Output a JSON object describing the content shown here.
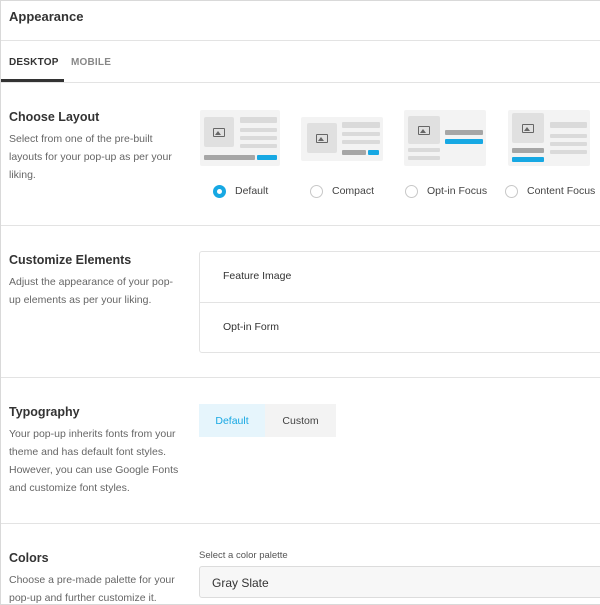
{
  "header": {
    "title": "Appearance"
  },
  "tabs": [
    {
      "label": "DESKTOP",
      "active": true
    },
    {
      "label": "MOBILE",
      "active": false
    }
  ],
  "layout_section": {
    "title": "Choose Layout",
    "description": "Select from one of the pre-built layouts for your pop-up as per your liking.",
    "options": [
      {
        "label": "Default",
        "selected": true
      },
      {
        "label": "Compact",
        "selected": false
      },
      {
        "label": "Opt-in Focus",
        "selected": false
      },
      {
        "label": "Content Focus",
        "selected": false
      }
    ]
  },
  "elements_section": {
    "title": "Customize Elements",
    "description": "Adjust the appearance of your pop-up elements as per your liking.",
    "items": [
      "Feature Image",
      "Opt-in Form"
    ]
  },
  "typography_section": {
    "title": "Typography",
    "description": "Your pop-up inherits fonts from your theme and has default font styles. However, you can use Google Fonts and customize font styles.",
    "options": [
      {
        "label": "Default",
        "active": true
      },
      {
        "label": "Custom",
        "active": false
      }
    ]
  },
  "colors_section": {
    "title": "Colors",
    "description": "Choose a pre-made palette for your pop-up and further customize it.",
    "palette_label": "Select a color palette",
    "palette_value": "Gray Slate"
  },
  "colors": {
    "accent": "#17a8e3",
    "border": "#e3e3e3",
    "text": "#333333"
  }
}
